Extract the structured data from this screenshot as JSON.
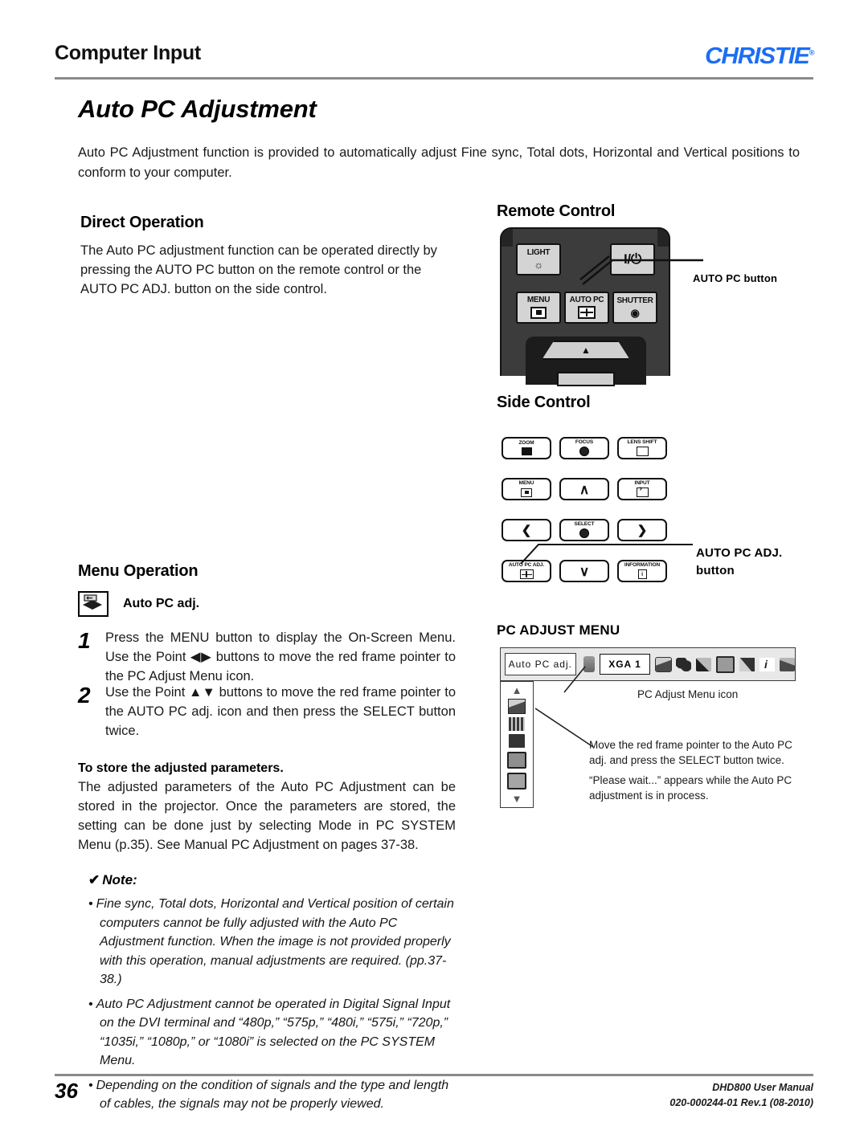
{
  "header": {
    "title": "Computer Input",
    "logo_text": "CHRISTIE",
    "logo_color": "#1b6ef3"
  },
  "doc_title": "Auto PC Adjustment",
  "intro": "Auto PC Adjustment function is provided to automatically adjust Fine sync, Total dots, Horizontal and Vertical positions to conform to your computer.",
  "left_column": {
    "direct_operation": {
      "heading": "Direct Operation",
      "body": "The Auto PC adjustment function can be operated directly by pressing the AUTO PC button on the remote control or the AUTO PC ADJ. button on the side control."
    },
    "menu_operation": {
      "heading": "Menu Operation",
      "icon_label": "Auto PC adj.",
      "steps": [
        {
          "number": "1",
          "text": "Press the MENU button to display the On-Screen Menu. Use the Point ◀▶ buttons to move the red frame pointer to the PC Adjust Menu icon."
        },
        {
          "number": "2",
          "text": "Use the Point ▲▼ buttons to move the red frame pointer to the AUTO PC adj. icon and then press the SELECT button twice."
        }
      ]
    },
    "store_parameters": {
      "heading": "To store the adjusted parameters.",
      "body": "The adjusted parameters of the Auto PC Adjustment can be stored in the projector. Once the parameters are stored, the setting can be done just by selecting Mode in PC SYSTEM Menu (p.35). See Manual PC Adjustment on pages 37-38."
    },
    "note": {
      "tick": "✔",
      "heading": "Note:",
      "items": [
        "Fine sync, Total dots, Horizontal and Vertical position of certain computers cannot be fully adjusted with the Auto PC Adjustment function. When the image is not provided properly with this operation, manual adjustments are required. (pp.37-38.)",
        "Auto PC Adjustment cannot be operated in Digital Signal Input on the DVI terminal and “480p,” “575p,” “480i,” “575i,” “720p,” “1035i,” “1080p,” or “1080i” is selected on the PC SYSTEM Menu.",
        "Depending on the condition of signals and the type and length of cables, the signals may not be properly viewed."
      ]
    }
  },
  "right_column": {
    "remote_control": {
      "heading": "Remote Control",
      "buttons": {
        "light": "LIGHT",
        "power": "I/⏻",
        "menu": "MENU",
        "auto_pc": "AUTO PC",
        "shutter": "SHUTTER"
      },
      "callout": "AUTO PC button"
    },
    "side_control": {
      "heading": "Side Control",
      "buttons": [
        "ZOOM",
        "FOCUS",
        "LENS SHIFT",
        "MENU",
        "",
        "INPUT",
        "",
        "SELECT",
        "",
        "AUTO PC ADJ.",
        "",
        "INFORMATION"
      ],
      "callout_line1": "AUTO PC ADJ.",
      "callout_line2": "button"
    },
    "pc_adjust_menu": {
      "heading": "PC ADJUST MENU",
      "osd_label": "Auto PC adj.",
      "osd_mode": "XGA 1",
      "caption": "PC Adjust Menu icon",
      "body1": "Move the red frame pointer to the Auto PC adj. and press the SELECT button twice.",
      "body2": "“Please wait...” appears while the Auto PC adjustment is in process."
    }
  },
  "footer": {
    "page_number": "36",
    "manual": "DHD800 User Manual",
    "part_number": "020-000244-01 Rev.1 (08-2010)"
  }
}
